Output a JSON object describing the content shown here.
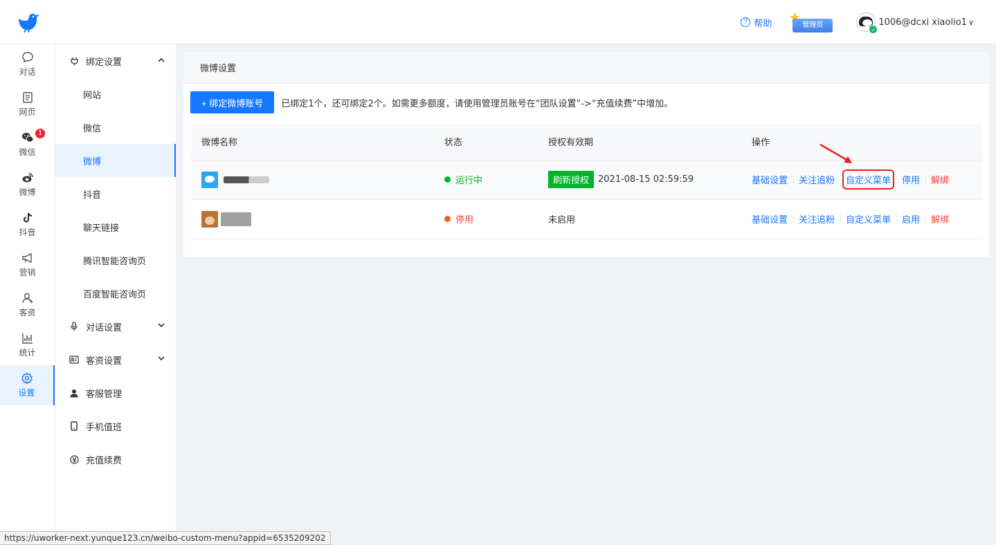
{
  "header": {
    "help_label": "帮助",
    "admin_badge": "管理员",
    "user_name": "1006@dcxi xiaolio1"
  },
  "nav": {
    "items": [
      {
        "label": "对话",
        "icon": "chat-bubble-icon"
      },
      {
        "label": "网页",
        "icon": "web-page-icon"
      },
      {
        "label": "微信",
        "icon": "wechat-icon",
        "badge": "1"
      },
      {
        "label": "微博",
        "icon": "weibo-icon"
      },
      {
        "label": "抖音",
        "icon": "douyin-icon"
      },
      {
        "label": "营销",
        "icon": "megaphone-icon"
      },
      {
        "label": "客资",
        "icon": "customer-icon"
      },
      {
        "label": "统计",
        "icon": "chart-icon"
      },
      {
        "label": "设置",
        "icon": "gear-icon",
        "active": true
      }
    ]
  },
  "sidebar": {
    "bind_settings": "绑定设置",
    "bind_items": [
      "网站",
      "微信",
      "微博",
      "抖音",
      "聊天链接",
      "腾讯智能咨询页",
      "百度智能咨询页"
    ],
    "active_item": "微博",
    "dialog_settings": "对话设置",
    "customer_settings": "客资设置",
    "service_management": "客服管理",
    "mobile_duty": "手机值班",
    "recharge": "充值续费"
  },
  "main": {
    "title": "微博设置",
    "bind_button": "+ 绑定微博账号",
    "tip": "已绑定1个，还可绑定2个。如需更多额度，请使用管理员账号在“团队设置”->“充值续费”中增加。",
    "columns": [
      "微博名称",
      "状态",
      "授权有效期",
      "操作"
    ],
    "rows": [
      {
        "status": "运行中",
        "refresh_label": "刷新授权",
        "expiry": "2021-08-15 02:59:59",
        "ops": [
          "基础设置",
          "关注追粉",
          "自定义菜单",
          "停用",
          "解绑"
        ]
      },
      {
        "status": "停用",
        "expiry": "未启用",
        "ops": [
          "基础设置",
          "关注追粉",
          "自定义菜单",
          "启用",
          "解绑"
        ]
      }
    ]
  },
  "statusbar": {
    "url": "https://uworker-next.yunque123.cn/weibo-custom-menu?appid=6535209202"
  },
  "colors": {
    "primary": "#1677ff",
    "success": "#00b42a",
    "danger": "#f53f3f",
    "highlight": "#e8221b"
  }
}
